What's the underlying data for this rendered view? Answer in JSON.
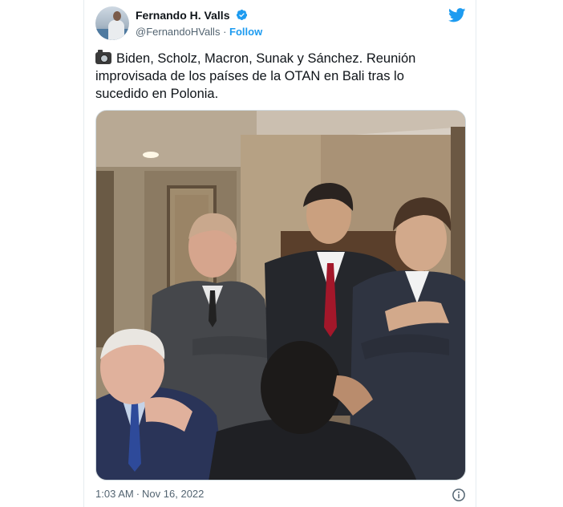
{
  "tweet": {
    "author": {
      "display_name": "Fernando H. Valls",
      "handle": "@FernandoHValls",
      "verified": true,
      "follow_label": "Follow",
      "dot": "·"
    },
    "text_icon": "camera-icon",
    "text": "Biden, Scholz, Macron, Sunak y Sánchez. Reunión improvisada de los países de la OTAN en Bali tras lo sucedido en Polonia.",
    "time": "1:03 AM",
    "date": "Nov 16, 2022",
    "meta_sep": "·"
  },
  "colors": {
    "accent": "#1d9bf0",
    "text": "#0f1419",
    "secondary": "#536471"
  },
  "icons": [
    "twitter-logo-icon",
    "verified-badge-icon",
    "camera-icon",
    "info-icon"
  ]
}
